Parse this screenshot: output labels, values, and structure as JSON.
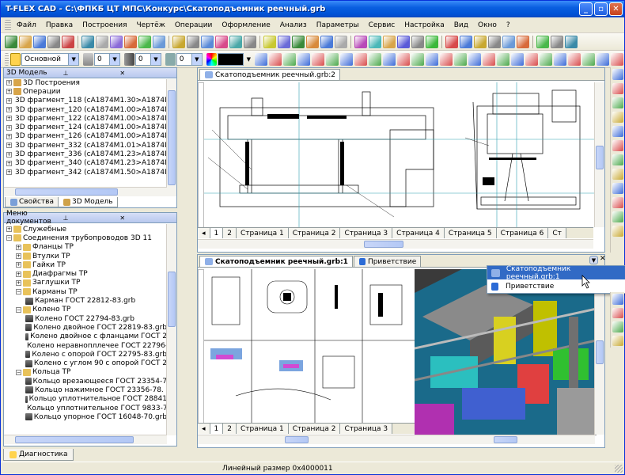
{
  "app": {
    "title": "T-FLEX CAD - C:\\ФПКБ ЦТ МПС\\Конкурс\\Скатоподъемник реечный.grb"
  },
  "menu": [
    "Файл",
    "Правка",
    "Построения",
    "Чертёж",
    "Операции",
    "Оформление",
    "Анализ",
    "Параметры",
    "Сервис",
    "Настройка",
    "Вид",
    "Окно",
    "?"
  ],
  "toolbar2": {
    "layer_value": "Основной",
    "num1": "0",
    "num2": "0",
    "num3": "0"
  },
  "model_panel": {
    "title": "3D Модель",
    "items": [
      "3D Построения",
      "Операции",
      "3D фрагмент_118 (сА1874М1.30>А1874М1.3(",
      "3D фрагмент_120 (сА1874М1.00>А1874М1.0(",
      "3D фрагмент_122 (сА1874М1.00>А1874М1.0(",
      "3D фрагмент_124 (сА1874М1.00>А1874М1.0(",
      "3D фрагмент_126 (сА1874М1.00>А1874М1.0(",
      "3D фрагмент_332 (сА1874М1.01>А1874М1.0(",
      "3D фрагмент_336 (сА1874М1.23>А1874М1.2(",
      "3D фрагмент_340 (сА1874М1.23>А1874М1.2(",
      "3D фрагмент_342 (сА1874М1.50>А1874М1.5("
    ],
    "tabs": [
      "Свойства",
      "3D Модель"
    ]
  },
  "docmenu": {
    "title": "Меню документов",
    "items": [
      {
        "t": "Служебные",
        "l": 0
      },
      {
        "t": "Соединения трубопроводов 3D 11",
        "l": 0
      },
      {
        "t": "Фланцы ТР",
        "l": 1
      },
      {
        "t": "Втулки ТР",
        "l": 1
      },
      {
        "t": "Гайки ТР",
        "l": 1
      },
      {
        "t": "Диафрагмы ТР",
        "l": 1
      },
      {
        "t": "Заглушки ТР",
        "l": 1
      },
      {
        "t": "Карманы ТР",
        "l": 1
      },
      {
        "t": "Карман ГОСТ 22812-83.grb",
        "l": 2
      },
      {
        "t": "Колено ТР",
        "l": 1
      },
      {
        "t": "Колено ГОСТ 22794-83.grb",
        "l": 2
      },
      {
        "t": "Колено двойное ГОСТ 22819-83.grb",
        "l": 2
      },
      {
        "t": "Колено двойное с фланцами ГОСТ 2",
        "l": 2
      },
      {
        "t": "Колено неравнопллечее ГОСТ 22796-8",
        "l": 2
      },
      {
        "t": "Колено с опорой ГОСТ 22795-83.grb",
        "l": 2
      },
      {
        "t": "Колено с углом 90 с опорой ГОСТ 2",
        "l": 2
      },
      {
        "t": "Кольца ТР",
        "l": 1
      },
      {
        "t": "Кольцо врезающееся ГОСТ 23354-7",
        "l": 2
      },
      {
        "t": "Кольцо нажимное ГОСТ 23356-78.",
        "l": 2
      },
      {
        "t": "Кольцо уплотнительное ГОСТ 28841",
        "l": 2
      },
      {
        "t": "Кольцо уплотнительное ГОСТ 9833-7",
        "l": 2
      },
      {
        "t": "Кольцо упорное ГОСТ 16048-70.grb",
        "l": 2
      }
    ]
  },
  "doc_top": {
    "tab": "Скатоподъемник реечный.grb:2",
    "pages": [
      "1",
      "2",
      "Страница 1",
      "Страница 2",
      "Страница 3",
      "Страница 4",
      "Страница 5",
      "Страница 6",
      "Ст"
    ]
  },
  "doc_bottom": {
    "tabs": [
      "Скатоподъемник реечный.grb:1",
      "Приветствие"
    ],
    "pages": [
      "1",
      "2",
      "Страница 1",
      "Страница 2",
      "Страница 3"
    ]
  },
  "popup": {
    "items": [
      "Скатоподъемник реечный.grb:1",
      "Приветствие"
    ]
  },
  "diag_tab": "Диагностика",
  "status": {
    "text": "Линейный размер 0x4000011"
  }
}
